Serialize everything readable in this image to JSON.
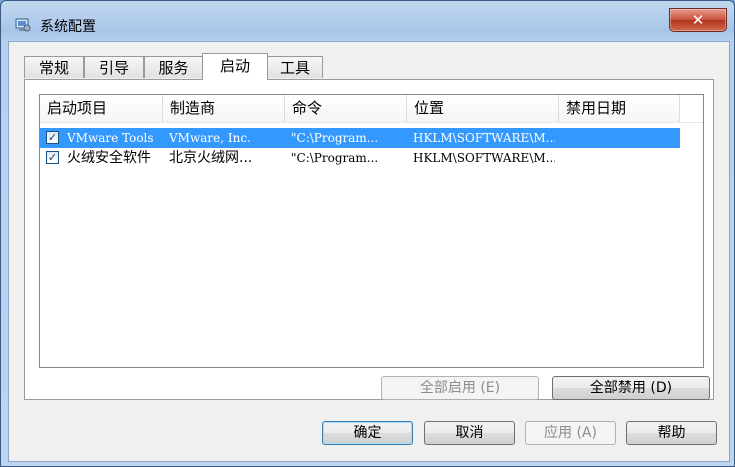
{
  "window": {
    "title": "系统配置",
    "close_label": "✕"
  },
  "tabs": [
    {
      "label": "常规"
    },
    {
      "label": "引导"
    },
    {
      "label": "服务"
    },
    {
      "label": "启动",
      "active": true
    },
    {
      "label": "工具"
    }
  ],
  "startup_list": {
    "columns": [
      "启动项目",
      "制造商",
      "命令",
      "位置",
      "禁用日期"
    ],
    "rows": [
      {
        "checked": true,
        "selected": true,
        "item": "VMware Tools",
        "manufacturer": "VMware, Inc.",
        "command": "\"C:\\Program...",
        "location": "HKLM\\SOFTWARE\\M...",
        "disabled_date": ""
      },
      {
        "checked": true,
        "selected": false,
        "item": "火绒安全软件",
        "manufacturer": "北京火绒网...",
        "command": "\"C:\\Program...",
        "location": "HKLM\\SOFTWARE\\M...",
        "disabled_date": ""
      }
    ]
  },
  "panel_buttons": {
    "enable_all": "全部启用 (E)",
    "disable_all": "全部禁用 (D)"
  },
  "dialog_buttons": {
    "ok": "确定",
    "cancel": "取消",
    "apply": "应用 (A)",
    "help": "帮助"
  },
  "colors": {
    "selection": "#3399ff",
    "title_gradient": "#a8c5e8",
    "close_button": "#c9503a"
  }
}
